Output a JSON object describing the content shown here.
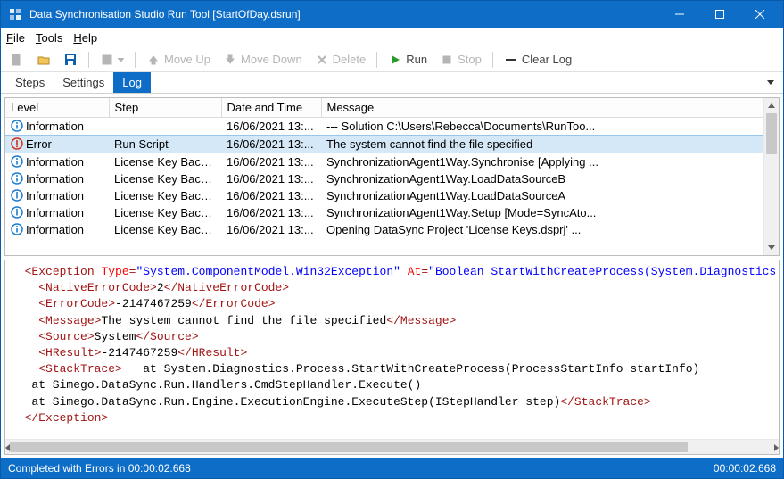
{
  "window": {
    "title": "Data Synchronisation Studio Run Tool [StartOfDay.dsrun]"
  },
  "menu": {
    "file": "File",
    "tools": "Tools",
    "help": "Help"
  },
  "toolbar": {
    "moveup": "Move Up",
    "movedown": "Move Down",
    "delete": "Delete",
    "run": "Run",
    "stop": "Stop",
    "clearlog": "Clear Log"
  },
  "tabs": {
    "steps": "Steps",
    "settings": "Settings",
    "log": "Log"
  },
  "table": {
    "headers": {
      "level": "Level",
      "step": "Step",
      "datetime": "Date and Time",
      "message": "Message"
    },
    "rows": [
      {
        "level": "Information",
        "icon": "info",
        "step": "",
        "datetime": "16/06/2021 13:...",
        "message": "--- Solution C:\\Users\\Rebecca\\Documents\\RunToo..."
      },
      {
        "level": "Error",
        "icon": "error",
        "step": "Run Script",
        "datetime": "16/06/2021 13:...",
        "message": "The system cannot find the file specified",
        "selected": true
      },
      {
        "level": "Information",
        "icon": "info",
        "step": "License Key Back...",
        "datetime": "16/06/2021 13:...",
        "message": "SynchronizationAgent1Way.Synchronise [Applying ..."
      },
      {
        "level": "Information",
        "icon": "info",
        "step": "License Key Back...",
        "datetime": "16/06/2021 13:...",
        "message": "SynchronizationAgent1Way.LoadDataSourceB"
      },
      {
        "level": "Information",
        "icon": "info",
        "step": "License Key Back...",
        "datetime": "16/06/2021 13:...",
        "message": "SynchronizationAgent1Way.LoadDataSourceA"
      },
      {
        "level": "Information",
        "icon": "info",
        "step": "License Key Back...",
        "datetime": "16/06/2021 13:...",
        "message": "SynchronizationAgent1Way.Setup [Mode=SyncAto..."
      },
      {
        "level": "Information",
        "icon": "info",
        "step": "License Key Back...",
        "datetime": "16/06/2021 13:...",
        "message": "Opening DataSync Project 'License Keys.dsprj' ..."
      }
    ]
  },
  "detail": {
    "exception_type": "System.ComponentModel.Win32Exception",
    "exception_at": "Boolean StartWithCreateProcess(System.Diagnostics.Process",
    "native_error_code": "2",
    "error_code": "-2147467259",
    "message": "The system cannot find the file specified",
    "source": "System",
    "hresult": "-2147467259",
    "stack1": "   at System.Diagnostics.Process.StartWithCreateProcess(ProcessStartInfo startInfo)",
    "stack2": "   at Simego.DataSync.Run.Handlers.CmdStepHandler.Execute()",
    "stack3": "   at Simego.DataSync.Run.Engine.ExecutionEngine.ExecuteStep(IStepHandler step)"
  },
  "status": {
    "left": "Completed with Errors in 00:00:02.668",
    "right": "00:00:02.668"
  }
}
